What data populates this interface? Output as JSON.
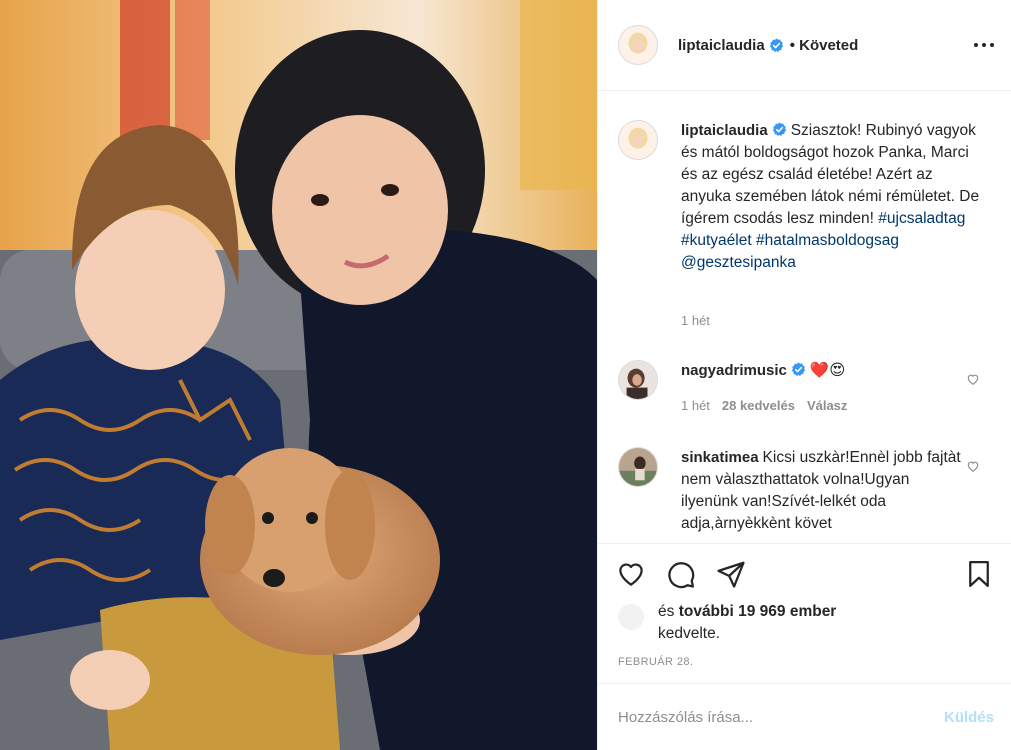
{
  "post": {
    "author": "liptaiclaudia",
    "follow_state": "• Követed",
    "caption": {
      "username": "liptaiclaudia",
      "text": "Sziasztok! Rubinyó vagyok és mától boldogságot hozok Panka, Marci és az egész család életébe! Azért az anyuka szemében látok némi rémületet. De ígérem csodás lesz minden!",
      "tags": [
        "#ujcsaladtag",
        "#kutyaélet",
        "#hatalmasboldogsag",
        "@gesztesipanka"
      ],
      "time": "1 hét"
    },
    "comments": [
      {
        "username": "nagyadrimusic",
        "verified": true,
        "text": "❤️😍",
        "time": "1 hét",
        "likes": "28 kedvelés",
        "reply": "Válasz"
      },
      {
        "username": "sinkatimea",
        "verified": false,
        "text": "Kicsi uszkàr!Ennèl jobb fajtàt nem vàlaszthattatok volna!Ugyan ilyenünk van!Szívét-lelkét oda adja,àrnyèkkènt követ"
      }
    ],
    "likes": {
      "prefix": "és",
      "count": "további 19 969 ember",
      "suffix": "kedvelte."
    },
    "date": "FEBRUÁR 28.",
    "add_comment": {
      "placeholder": "Hozzászólás írása...",
      "post_label": "Küldés"
    },
    "icons": {
      "like": "heart-icon",
      "comment": "comment-icon",
      "share": "paper-plane-icon",
      "save": "bookmark-icon",
      "more": "more-options-icon",
      "verified": "verified-badge-icon"
    },
    "colors": {
      "verified_blue": "#3897f0",
      "hashtag": "#00376b",
      "muted": "#8e8e8e",
      "post_button_disabled": "#b2dffc"
    }
  }
}
